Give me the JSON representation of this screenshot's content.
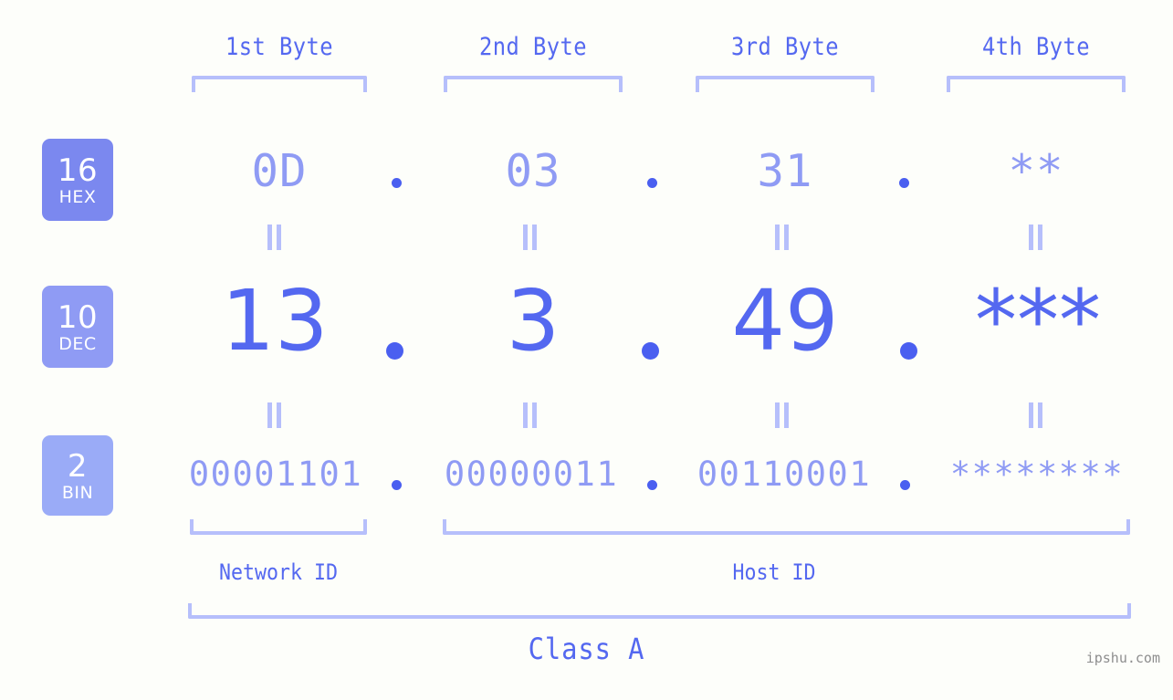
{
  "meta": {
    "background_color": "#fdfefa",
    "accent_strong": "#5468f0",
    "accent_mid": "#8f9bf4",
    "accent_light": "#b6bffb",
    "dot_color": "#4a5ff0",
    "watermark_color": "#8e8e8e"
  },
  "header": {
    "bytes": [
      {
        "label": "1st Byte"
      },
      {
        "label": "2nd Byte"
      },
      {
        "label": "3rd Byte"
      },
      {
        "label": "4th Byte"
      }
    ]
  },
  "radix_badges": [
    {
      "number": "16",
      "name": "HEX",
      "color": "#7b88ef"
    },
    {
      "number": "10",
      "name": "DEC",
      "color": "#8f9bf4"
    },
    {
      "number": "2",
      "name": "BIN",
      "color": "#9aabf7"
    }
  ],
  "rows": {
    "hex": {
      "values": [
        "0D",
        "03",
        "31",
        "**"
      ],
      "separator": "."
    },
    "dec": {
      "values": [
        "13",
        "3",
        "49",
        "***"
      ],
      "separator": "."
    },
    "bin": {
      "values": [
        "00001101",
        "00000011",
        "00110001",
        "********"
      ],
      "separator": "."
    }
  },
  "equality_marks": {
    "symbol": "||",
    "rows": [
      "hex-to-dec",
      "dec-to-bin"
    ],
    "count_per_row": 4
  },
  "regions": [
    {
      "label": "Network ID",
      "bytes": 1
    },
    {
      "label": "Host ID",
      "bytes": 3
    }
  ],
  "class": {
    "label": "Class A"
  },
  "watermark": {
    "text": "ipshu.com"
  }
}
